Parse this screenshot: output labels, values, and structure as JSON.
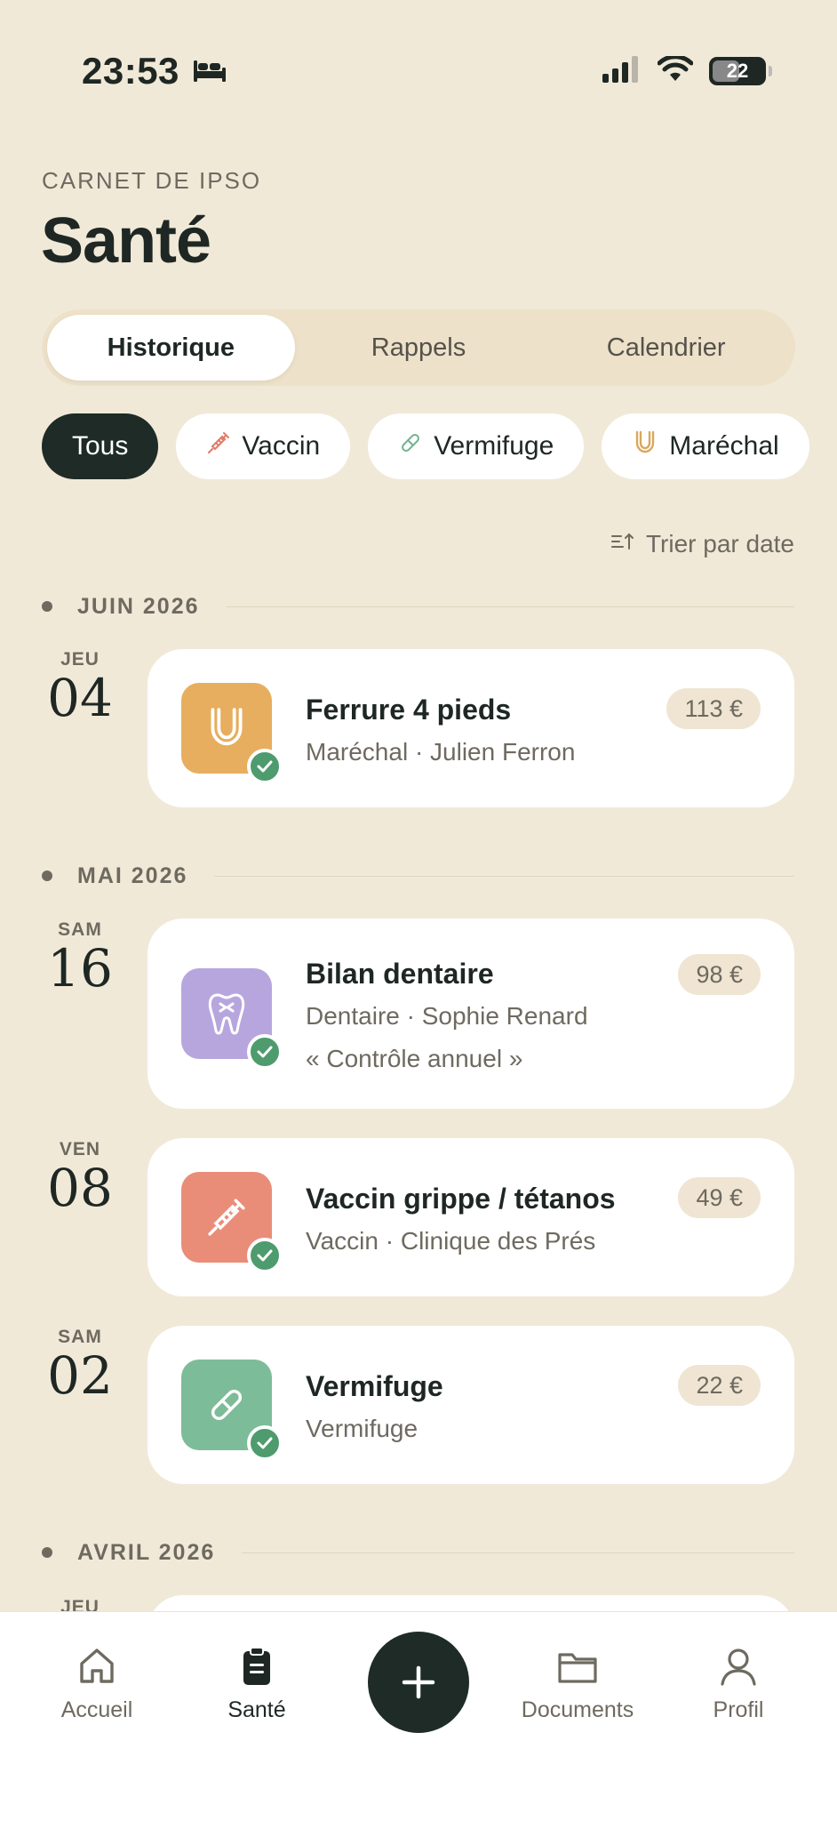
{
  "status": {
    "time": "23:53",
    "battery": "22"
  },
  "header": {
    "eyebrow": "CARNET DE IPSO",
    "title": "Santé"
  },
  "tabs": [
    {
      "label": "Historique",
      "active": true
    },
    {
      "label": "Rappels",
      "active": false
    },
    {
      "label": "Calendrier",
      "active": false
    }
  ],
  "filters": [
    {
      "label": "Tous",
      "active": true,
      "icon": "none"
    },
    {
      "label": "Vaccin",
      "active": false,
      "icon": "syringe-icon"
    },
    {
      "label": "Vermifuge",
      "active": false,
      "icon": "pill-icon"
    },
    {
      "label": "Maréchal",
      "active": false,
      "icon": "horseshoe-icon"
    }
  ],
  "sort": {
    "label": "Trier par date"
  },
  "months": [
    {
      "label": "JUIN 2026"
    },
    {
      "label": "MAI 2026"
    },
    {
      "label": "AVRIL 2026"
    }
  ],
  "events": [
    {
      "dow": "JEU",
      "day": "04",
      "title": "Ferrure 4 pieds",
      "subtitle": "Maréchal · Julien Ferron",
      "note": "",
      "price": "113 €",
      "icon": "horseshoe-icon",
      "color": "#E6AE5E",
      "done": true
    },
    {
      "dow": "SAM",
      "day": "16",
      "title": "Bilan dentaire",
      "subtitle": "Dentaire · Sophie Renard",
      "note": "« Contrôle annuel »",
      "price": "98 €",
      "icon": "tooth-icon",
      "color": "#B7A6DE",
      "done": true
    },
    {
      "dow": "VEN",
      "day": "08",
      "title": "Vaccin grippe / tétanos",
      "subtitle": "Vaccin · Clinique des Prés",
      "note": "",
      "price": "49 €",
      "icon": "syringe-icon",
      "color": "#E98D79",
      "done": true
    },
    {
      "dow": "SAM",
      "day": "02",
      "title": "Vermifuge",
      "subtitle": "Vermifuge",
      "note": "",
      "price": "22 €",
      "icon": "pill-icon",
      "color": "#7DBC98",
      "done": true
    },
    {
      "dow": "JEU",
      "day": "",
      "title": "",
      "subtitle": "",
      "note": "",
      "price": "",
      "icon": "",
      "color": "#FFFFFF",
      "done": false
    }
  ],
  "nav": [
    {
      "label": "Accueil",
      "icon": "home-icon",
      "active": false
    },
    {
      "label": "Santé",
      "icon": "clipboard-icon",
      "active": true
    },
    {
      "label": "",
      "icon": "plus-icon",
      "active": false
    },
    {
      "label": "Documents",
      "icon": "folder-icon",
      "active": false
    },
    {
      "label": "Profil",
      "icon": "user-icon",
      "active": false
    }
  ],
  "colors": {
    "background": "#F1E9D8",
    "accent_dark": "#1E2B26",
    "check_green": "#4E9B6E"
  }
}
